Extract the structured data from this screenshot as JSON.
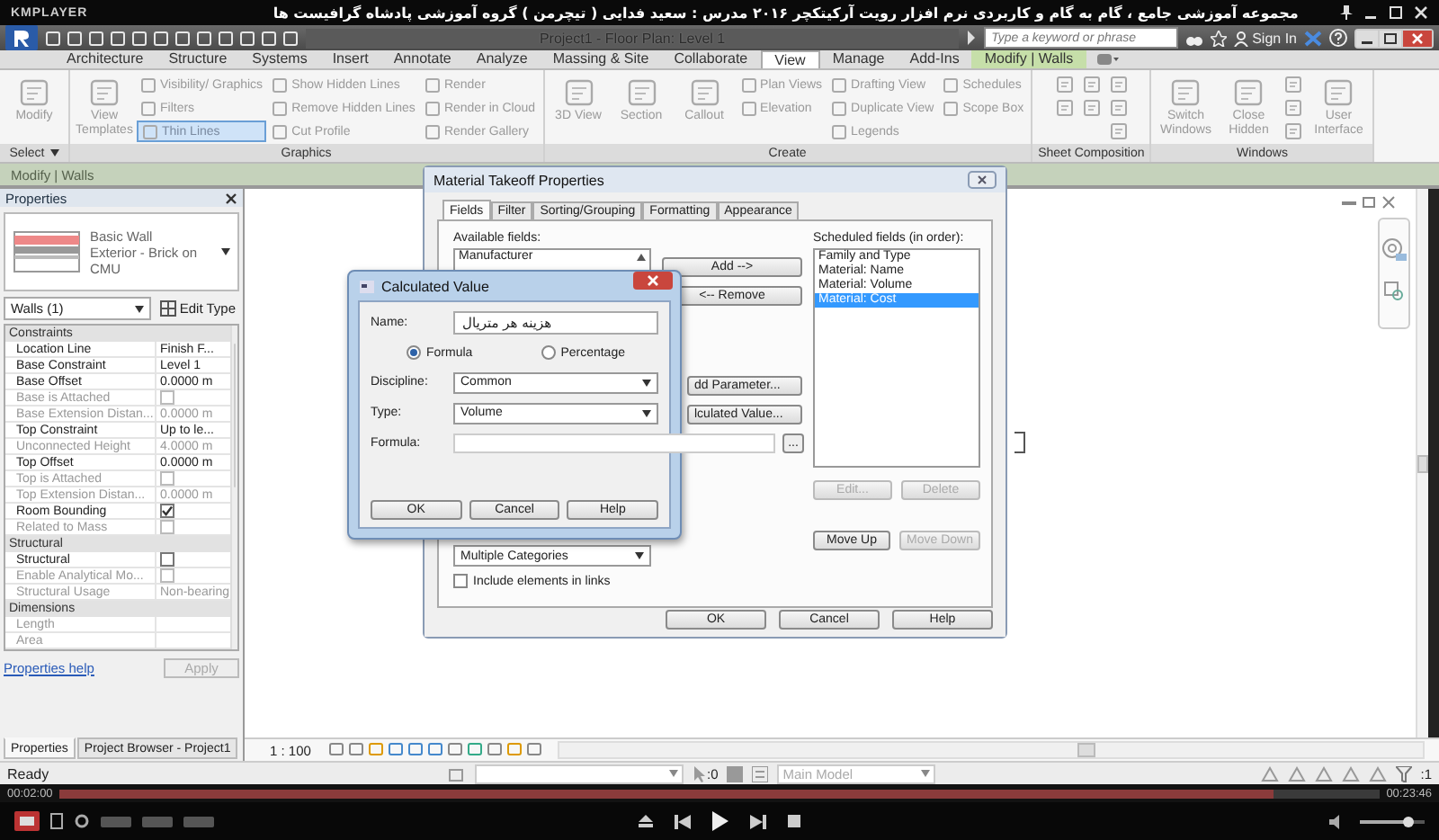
{
  "player": {
    "app_name": "KMPLAYER",
    "title": "مجموعه آموزشی جامع ، گام به گام و کاربردی نرم افزار رویت آرکیتکچر ۲۰۱۶   مدرس : سعید فدایی ( تیچرمن ) گروه آموزشی پادشاه گرافیست ها",
    "time_elapsed": "00:02:00",
    "time_total": "00:23:46",
    "progress": {
      "level": 0.92
    },
    "volume": {
      "level": 0.75
    }
  },
  "revit": {
    "window_title": "Project1 - Floor Plan: Level 1",
    "search": {
      "placeholder": "Type a keyword or phrase"
    },
    "sign_in": "Sign In",
    "tabs": [
      {
        "label": "Architecture",
        "selected": false,
        "kind": "normal"
      },
      {
        "label": "Structure",
        "selected": false,
        "kind": "normal"
      },
      {
        "label": "Systems",
        "selected": false,
        "kind": "normal"
      },
      {
        "label": "Insert",
        "selected": false,
        "kind": "normal"
      },
      {
        "label": "Annotate",
        "selected": false,
        "kind": "normal"
      },
      {
        "label": "Analyze",
        "selected": false,
        "kind": "normal"
      },
      {
        "label": "Massing & Site",
        "selected": false,
        "kind": "normal"
      },
      {
        "label": "Collaborate",
        "selected": false,
        "kind": "normal"
      },
      {
        "label": "View",
        "selected": true,
        "kind": "normal"
      },
      {
        "label": "Manage",
        "selected": false,
        "kind": "normal"
      },
      {
        "label": "Add-Ins",
        "selected": false,
        "kind": "normal"
      },
      {
        "label": "Modify | Walls",
        "selected": false,
        "kind": "contextual"
      }
    ],
    "ribbon_panels": [
      {
        "label": "Select",
        "menu": true,
        "columns": [
          {
            "tools": [
              {
                "label": "Modify",
                "kind": "large",
                "on": false
              }
            ]
          }
        ]
      },
      {
        "label": "Graphics",
        "columns": [
          {
            "tools": [
              {
                "label": "View Templates",
                "kind": "large",
                "on": false
              }
            ]
          },
          {
            "tools": [
              {
                "label": "Visibility/ Graphics",
                "kind": "small",
                "on": false
              },
              {
                "label": "Filters",
                "kind": "small",
                "on": false
              },
              {
                "label": "Thin Lines",
                "kind": "small",
                "on": true
              }
            ]
          },
          {
            "tools": [
              {
                "label": "Show Hidden Lines",
                "kind": "small",
                "on": false
              },
              {
                "label": "Remove Hidden Lines",
                "kind": "small",
                "on": false
              },
              {
                "label": "Cut Profile",
                "kind": "small",
                "on": false
              }
            ]
          },
          {
            "tools": [
              {
                "label": "Render",
                "kind": "small",
                "on": false
              },
              {
                "label": "Render in Cloud",
                "kind": "small",
                "on": false
              },
              {
                "label": "Render Gallery",
                "kind": "small",
                "on": false
              }
            ]
          }
        ]
      },
      {
        "label": "Create",
        "columns": [
          {
            "tools": [
              {
                "label": "3D View",
                "kind": "large",
                "on": false
              }
            ]
          },
          {
            "tools": [
              {
                "label": "Section",
                "kind": "large",
                "on": false
              }
            ]
          },
          {
            "tools": [
              {
                "label": "Callout",
                "kind": "large",
                "on": false
              }
            ]
          },
          {
            "tools": [
              {
                "label": "Plan Views",
                "kind": "small",
                "on": false
              },
              {
                "label": "Elevation",
                "kind": "small",
                "on": false
              }
            ]
          },
          {
            "tools": [
              {
                "label": "Drafting View",
                "kind": "small",
                "on": false
              },
              {
                "label": "Duplicate View",
                "kind": "small",
                "on": false
              },
              {
                "label": "Legends",
                "kind": "small",
                "on": false
              }
            ]
          },
          {
            "tools": [
              {
                "label": "Schedules",
                "kind": "small",
                "on": false
              },
              {
                "label": "Scope Box",
                "kind": "small",
                "on": false
              }
            ]
          }
        ]
      },
      {
        "label": "Sheet Composition",
        "columns": [
          {
            "tools": [
              {
                "kind": "icon",
                "on": false
              },
              {
                "kind": "icon",
                "on": false
              }
            ]
          },
          {
            "tools": [
              {
                "kind": "icon",
                "on": false
              },
              {
                "kind": "icon",
                "on": false
              }
            ]
          },
          {
            "tools": [
              {
                "kind": "icon",
                "on": false
              },
              {
                "kind": "icon",
                "on": false
              },
              {
                "kind": "icon",
                "on": false
              }
            ]
          }
        ]
      },
      {
        "label": "Windows",
        "columns": [
          {
            "tools": [
              {
                "label": "Switch Windows",
                "kind": "large",
                "on": false
              }
            ]
          },
          {
            "tools": [
              {
                "label": "Close Hidden",
                "kind": "large",
                "on": false
              }
            ]
          },
          {
            "tools": [
              {
                "kind": "icon",
                "on": false
              },
              {
                "kind": "icon",
                "on": false
              },
              {
                "kind": "icon",
                "on": false
              }
            ]
          },
          {
            "tools": [
              {
                "label": "User Interface",
                "kind": "large",
                "on": false
              }
            ]
          }
        ]
      }
    ],
    "context_bar": "Modify | Walls",
    "properties": {
      "title": "Properties",
      "type_name": "Basic Wall",
      "type_detail": "Exterior - Brick on CMU",
      "selector": "Walls (1)",
      "edit_type": "Edit Type",
      "groups": [
        {
          "name": "Constraints",
          "rows": [
            {
              "label": "Location Line",
              "value": "Finish F...",
              "kind": "text",
              "disabled": false
            },
            {
              "label": "Base Constraint",
              "value": "Level 1",
              "kind": "text",
              "disabled": false
            },
            {
              "label": "Base Offset",
              "value": "0.0000 m",
              "kind": "text",
              "disabled": false
            },
            {
              "label": "Base is Attached",
              "kind": "check",
              "checked": false,
              "disabled": true
            },
            {
              "label": "Base Extension Distan...",
              "value": "0.0000 m",
              "kind": "text",
              "disabled": true
            },
            {
              "label": "Top Constraint",
              "value": "Up to le...",
              "kind": "text",
              "disabled": false
            },
            {
              "label": "Unconnected Height",
              "value": "4.0000 m",
              "kind": "text",
              "disabled": true
            },
            {
              "label": "Top Offset",
              "value": "0.0000 m",
              "kind": "text",
              "disabled": false
            },
            {
              "label": "Top is Attached",
              "kind": "check",
              "checked": false,
              "disabled": true
            },
            {
              "label": "Top Extension Distan...",
              "value": "0.0000 m",
              "kind": "text",
              "disabled": true
            },
            {
              "label": "Room Bounding",
              "kind": "check",
              "checked": true,
              "disabled": false
            },
            {
              "label": "Related to Mass",
              "kind": "check",
              "checked": false,
              "disabled": true
            }
          ]
        },
        {
          "name": "Structural",
          "rows": [
            {
              "label": "Structural",
              "kind": "check",
              "checked": false,
              "disabled": false
            },
            {
              "label": "Enable Analytical Mo...",
              "kind": "check",
              "checked": false,
              "disabled": true
            },
            {
              "label": "Structural Usage",
              "value": "Non-bearing",
              "kind": "text",
              "disabled": true
            }
          ]
        },
        {
          "name": "Dimensions",
          "rows": [
            {
              "label": "Length",
              "kind": "text",
              "disabled": true
            },
            {
              "label": "Area",
              "kind": "text",
              "disabled": true
            }
          ]
        }
      ],
      "help_link": "Properties help",
      "apply": "Apply",
      "tabs": [
        {
          "label": "Properties",
          "selected": true
        },
        {
          "label": "Project Browser - Project1",
          "selected": false
        }
      ]
    },
    "view_scale": "1 : 100",
    "status": "Ready",
    "selection_count": ":0",
    "workset": "Main Model",
    "filter_count": ":1"
  },
  "material_takeoff": {
    "title": "Material Takeoff Properties",
    "tabs": [
      {
        "label": "Fields",
        "selected": true
      },
      {
        "label": "Filter",
        "selected": false
      },
      {
        "label": "Sorting/Grouping",
        "selected": false
      },
      {
        "label": "Formatting",
        "selected": false
      },
      {
        "label": "Appearance",
        "selected": false
      }
    ],
    "available_label": "Available fields:",
    "available_fields": [
      "Manufacturer"
    ],
    "add": "Add -->",
    "remove": "<-- Remove",
    "add_parameter": "dd Parameter...",
    "calculated_value": "lculated Value...",
    "scheduled_label": "Scheduled fields (in order):",
    "scheduled_fields": [
      {
        "label": "Family and Type",
        "selected": false
      },
      {
        "label": "Material: Name",
        "selected": false
      },
      {
        "label": "Material: Volume",
        "selected": false
      },
      {
        "label": "Material: Cost",
        "selected": true
      }
    ],
    "field_buttons": [
      {
        "label": "Edit...",
        "disabled": true
      },
      {
        "label": "Delete",
        "disabled": true
      },
      {
        "label": "Move Up",
        "disabled": false
      },
      {
        "label": "Move Down",
        "disabled": true
      }
    ],
    "category": "Multiple Categories",
    "include_links": {
      "label": "Include elements in links",
      "checked": false
    },
    "buttons": [
      "OK",
      "Cancel",
      "Help"
    ]
  },
  "calculated_value": {
    "title": "Calculated Value",
    "name_label": "Name:",
    "name_value": "هزینه هر متریال",
    "modes": [
      {
        "label": "Formula",
        "selected": true
      },
      {
        "label": "Percentage",
        "selected": false
      }
    ],
    "discipline_label": "Discipline:",
    "discipline": "Common",
    "type_label": "Type:",
    "type": "Volume",
    "formula_label": "Formula:",
    "browse": "...",
    "buttons": [
      "OK",
      "Cancel",
      "Help"
    ]
  }
}
